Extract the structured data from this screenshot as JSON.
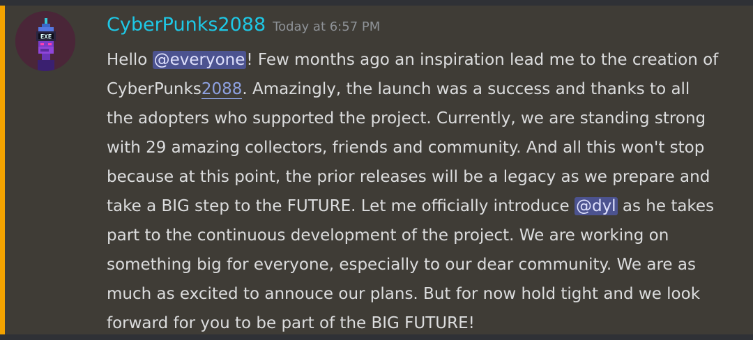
{
  "message": {
    "author": "CyberPunks2088",
    "timestamp": "Today at 6:57 PM",
    "colors": {
      "author": "#1ec8e6",
      "highlight_bar": "#f4a300",
      "mention_bg": "#4c5390",
      "background": "#3f3c36"
    },
    "avatar_icon": "cyberpunk-robot-avatar",
    "lines": [
      [
        "Hello ",
        "@everyone",
        "! Few months ago an inspiration lead me to the creation of"
      ],
      [
        "CyberPunks",
        "2088",
        ". Amazingly, the launch was a success and thanks to all"
      ],
      [
        "the adopters who supported the project. Currently, we are standing strong"
      ],
      [
        "with 29 amazing collectors, friends and community. And all this won't stop"
      ],
      [
        "because at this point, the prior releases will be a legacy as we prepare and"
      ],
      [
        "take a BIG step to the FUTURE. Let me officially introduce ",
        "@dyl",
        " as he takes"
      ],
      [
        "part to the continuous development of the project. We are working on"
      ],
      [
        "something big for everyone, especially to our dear community. We are as"
      ],
      [
        "much as excited to annouce our plans. But for now hold tight and we look"
      ],
      [
        "forward for you to be part of the BIG FUTURE!"
      ]
    ]
  }
}
